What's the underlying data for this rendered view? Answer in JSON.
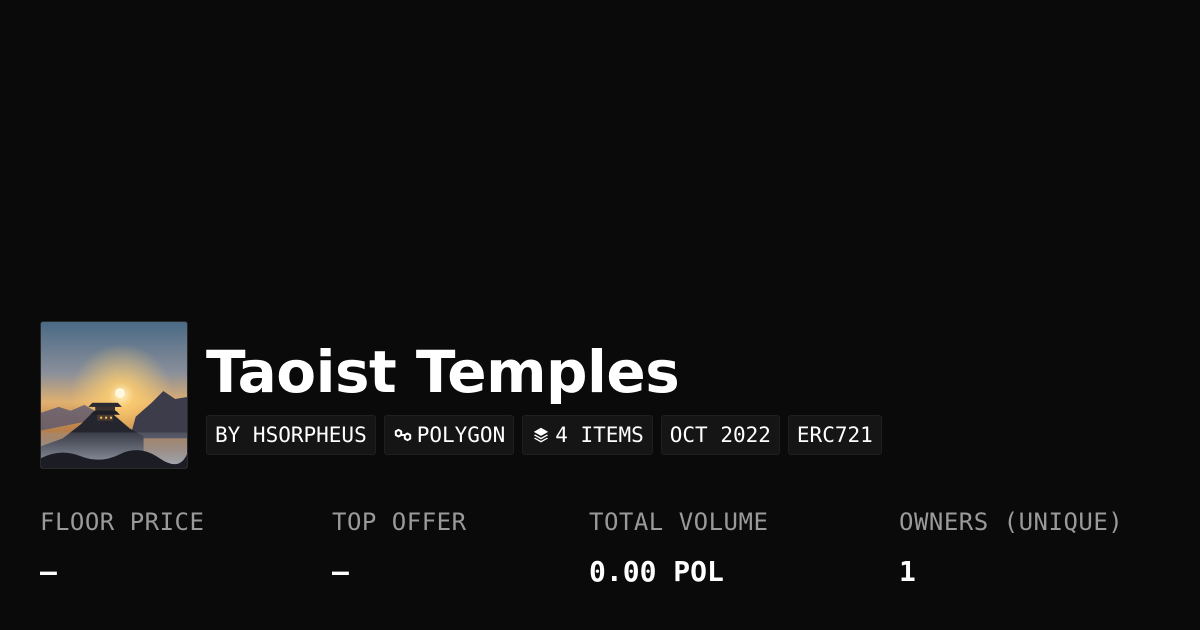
{
  "collection": {
    "title": "Taoist Temples",
    "image_icon": "temple-sunset-image"
  },
  "tags": [
    {
      "label": "BY HSORPHEUS",
      "icon": null
    },
    {
      "label": "POLYGON",
      "icon": "polygon-icon"
    },
    {
      "label": "4 ITEMS",
      "icon": "layers-icon"
    },
    {
      "label": "OCT 2022",
      "icon": null
    },
    {
      "label": "ERC721",
      "icon": null
    }
  ],
  "stats": [
    {
      "label": "FLOOR PRICE",
      "value": "–"
    },
    {
      "label": "TOP OFFER",
      "value": "–"
    },
    {
      "label": "TOTAL VOLUME",
      "value": "0.00 POL"
    },
    {
      "label": "OWNERS (UNIQUE)",
      "value": "1"
    }
  ],
  "colors": {
    "background": "#0a0a0a",
    "text": "#ffffff",
    "muted": "#9a9a9a",
    "pill_bg": "#151515"
  }
}
